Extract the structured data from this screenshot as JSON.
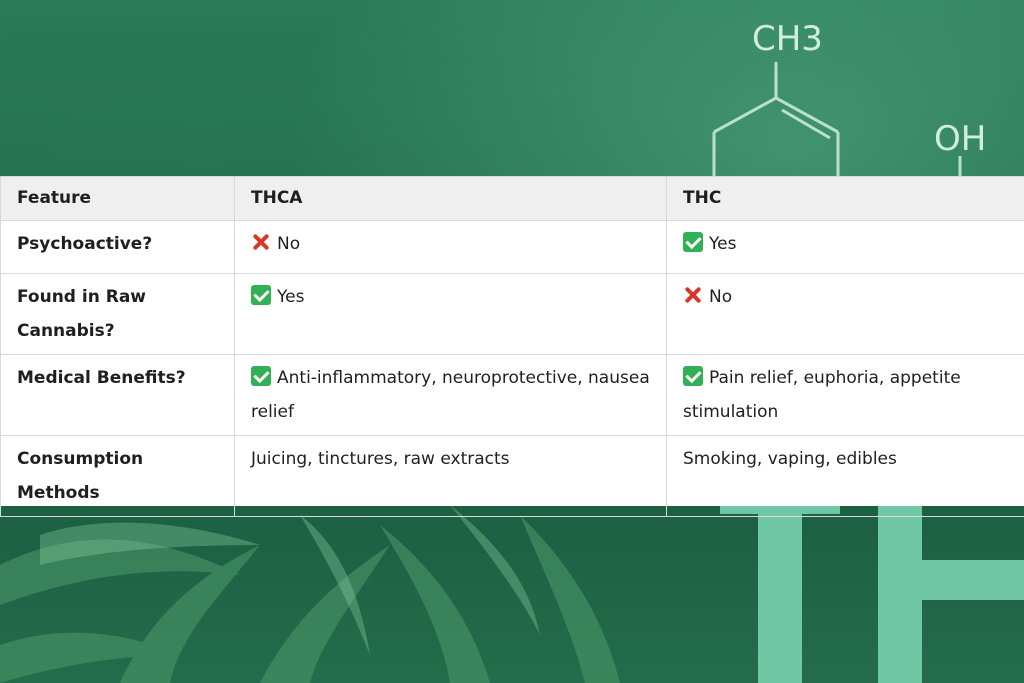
{
  "background": {
    "molecule_labels": [
      "CH3",
      "OH"
    ],
    "letters": "TH"
  },
  "table": {
    "headers": [
      "Feature",
      "THCA",
      "THC"
    ],
    "rows": [
      {
        "feature": "Psychoactive?",
        "thca": {
          "icon": "cross-icon",
          "text": "No"
        },
        "thc": {
          "icon": "check-icon",
          "text": "Yes"
        }
      },
      {
        "feature": "Found in Raw Cannabis?",
        "thca": {
          "icon": "check-icon",
          "text": "Yes"
        },
        "thc": {
          "icon": "cross-icon",
          "text": "No"
        }
      },
      {
        "feature": "Medical Benefits?",
        "thca": {
          "icon": "check-icon",
          "text": "Anti-inflammatory, neuroprotective, nausea relief"
        },
        "thc": {
          "icon": "check-icon",
          "text": "Pain relief, euphoria, appetite stimulation"
        }
      },
      {
        "feature": "Consumption Methods",
        "thca": {
          "icon": "",
          "text": "Juicing, tinctures, raw extracts"
        },
        "thc": {
          "icon": "",
          "text": "Smoking, vaping, edibles"
        }
      }
    ]
  },
  "colors": {
    "check": "#31b155",
    "cross": "#d6392a",
    "header_bg": "#efefef",
    "background_green": "#1f6a4b",
    "letter_green": "#70c7a6"
  }
}
